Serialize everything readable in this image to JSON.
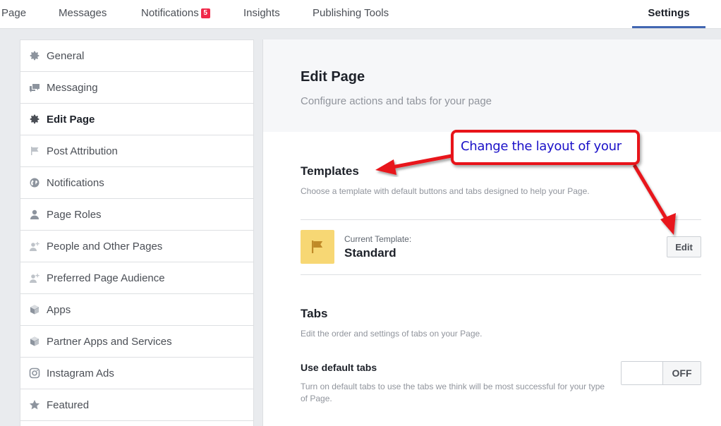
{
  "topnav": {
    "items": [
      {
        "label": "Page"
      },
      {
        "label": "Messages"
      },
      {
        "label": "Notifications",
        "badge": "5"
      },
      {
        "label": "Insights"
      },
      {
        "label": "Publishing Tools"
      },
      {
        "label": "Settings"
      }
    ],
    "active": "Settings"
  },
  "sidebar": {
    "items": [
      {
        "label": "General",
        "icon": "gear-icon"
      },
      {
        "label": "Messaging",
        "icon": "chat-bubbles-icon"
      },
      {
        "label": "Edit Page",
        "icon": "gear-icon"
      },
      {
        "label": "Post Attribution",
        "icon": "flag-icon"
      },
      {
        "label": "Notifications",
        "icon": "globe-icon"
      },
      {
        "label": "Page Roles",
        "icon": "person-icon"
      },
      {
        "label": "People and Other Pages",
        "icon": "person-plus-icon"
      },
      {
        "label": "Preferred Page Audience",
        "icon": "person-plus-icon"
      },
      {
        "label": "Apps",
        "icon": "cube-icon"
      },
      {
        "label": "Partner Apps and Services",
        "icon": "cube-icon"
      },
      {
        "label": "Instagram Ads",
        "icon": "instagram-icon"
      },
      {
        "label": "Featured",
        "icon": "star-icon"
      }
    ],
    "active": "Edit Page"
  },
  "main": {
    "title": "Edit Page",
    "subtitle": "Configure actions and tabs for your page",
    "templates": {
      "title": "Templates",
      "description": "Choose a template with default buttons and tabs designed to help your Page.",
      "current_label": "Current Template:",
      "current_value": "Standard",
      "edit_label": "Edit",
      "icon": "flag-icon"
    },
    "tabs": {
      "title": "Tabs",
      "description": "Edit the order and settings of tabs on your Page.",
      "option_title": "Use default tabs",
      "option_description": "Turn on default tabs to use the tabs we think will be most successful for your type of Page.",
      "toggle_label": "OFF"
    }
  },
  "annotation": {
    "text": "Change the layout of your",
    "border_color": "#e8141a",
    "text_color": "#1a10c8"
  },
  "colors": {
    "accent": "#4267b2",
    "badge": "#f02849",
    "template_icon_bg": "#f7d774"
  }
}
